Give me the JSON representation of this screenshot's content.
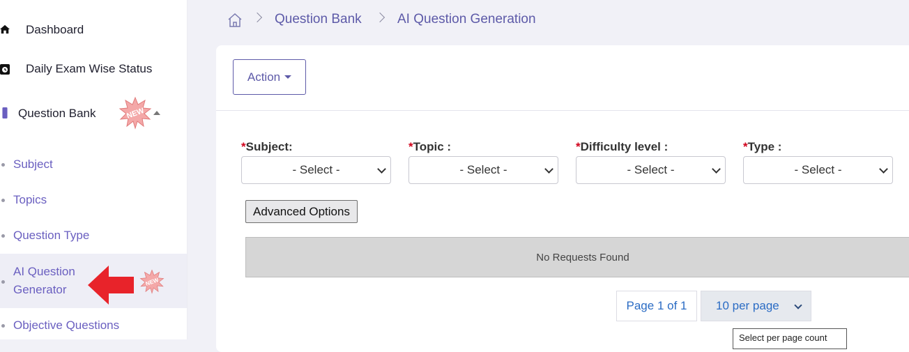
{
  "sidebar": {
    "dashboard": "Dashboard",
    "daily_exam": "Daily Exam Wise Status",
    "question_bank": "Question Bank",
    "sub_items": [
      "Subject",
      "Topics",
      "Question Type",
      "AI Question Generator",
      "Objective Questions"
    ],
    "new_badge": "NEW"
  },
  "breadcrumb": [
    "Question Bank",
    "AI Question Generation"
  ],
  "toolbar": {
    "action_label": "Action"
  },
  "filters": [
    {
      "label": "Subject:",
      "value": "- Select -"
    },
    {
      "label": "Topic :",
      "value": "- Select -"
    },
    {
      "label": "Difficulty level :",
      "value": "- Select -"
    },
    {
      "label": "Type :",
      "value": "- Select -"
    }
  ],
  "required_mark": "*",
  "advanced_label": "Advanced Options",
  "empty_message": "No Requests Found",
  "pagination": {
    "page_info": "Page 1 of 1",
    "per_page": "10 per page",
    "tooltip": "Select per page count"
  },
  "colors": {
    "accent": "#5d5aa8",
    "link": "#2b6cc4",
    "required": "#d0021b",
    "arrow": "#e8232a"
  }
}
